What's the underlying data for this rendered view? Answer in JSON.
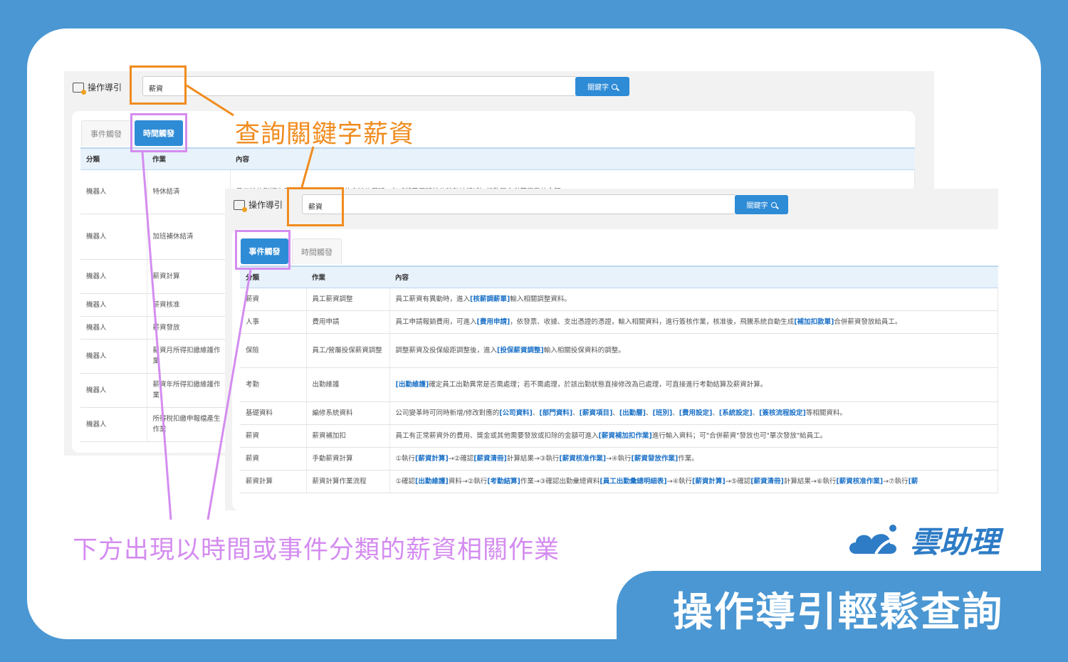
{
  "guide_label": "操作導引",
  "search": {
    "value": "薪資",
    "button": "關鍵字"
  },
  "tabs": {
    "event": "事件觸發",
    "time": "時間觸發"
  },
  "headers": [
    "分類",
    "作業",
    "內容"
  ],
  "panel1_rows": [
    {
      "cat": "機器人",
      "job": "特休結清",
      "content": "員工特休到期次日，系統執行當年未休完特休展延一年或將已展延特休時數結轉補加扣款單合併薪資發放金額。"
    },
    {
      "cat": "機器人",
      "job": "加班補休結清",
      "content": ""
    },
    {
      "cat": "機器人",
      "job": "薪資計算",
      "content": ""
    },
    {
      "cat": "機器人",
      "job": "薪資核准",
      "content": ""
    },
    {
      "cat": "機器人",
      "job": "薪資發放",
      "content": ""
    },
    {
      "cat": "機器人",
      "job": "薪資月所得扣繳維護作業",
      "content": ""
    },
    {
      "cat": "機器人",
      "job": "薪資年所得扣繳維護作業",
      "content": ""
    },
    {
      "cat": "機器人",
      "job": "所得稅扣繳申報檔產生作業",
      "content": ""
    }
  ],
  "panel2_rows": [
    {
      "cat": "薪資",
      "job": "員工薪資調整",
      "content": "員工薪資有異動時，進入[核薪調薪單]輸入相關調整資料。"
    },
    {
      "cat": "人事",
      "job": "費用申請",
      "content": "員工申請報銷費用，可進入[費用申請]，依發票、收據、支出憑證的憑證，輸入相關資料，進行簽核作業，核准後，飛騰系統自動生成[補加扣款單]合併薪資發放給員工。"
    },
    {
      "cat": "保險",
      "job": "員工/營屬投保薪資調整",
      "content": "調整薪資及投保級距調整後，進入[投保薪資調整]輸入相關投保資料的調整。"
    },
    {
      "cat": "考勤",
      "job": "出勤維護",
      "content": "[出勤維護]確定員工出勤異常是否需處理；若不需處理，於該出勤狀態直接修改為已處理，可直接進行考勤結算及薪資計算。"
    },
    {
      "cat": "基礎資料",
      "job": "編修系統資料",
      "content": "公司變革時可同時新增/修改對應的[公司資料]、[部門資料]、[薪資項目]、[出勤曆]、[班別]、[費用設定]、[系統設定]、[簽核流程設定]等相關資料。"
    },
    {
      "cat": "薪資",
      "job": "薪資補加扣",
      "content": "員工有正常薪資外的費用、獎金或其他需要發放或扣除的金額可進入[薪資補加扣作業]進行輸入資料；可\"合併薪資\"發放也可\"單次發放\"給員工。"
    },
    {
      "cat": "薪資",
      "job": "手動薪資計算",
      "content": "①執行[薪資計算]→②確認[薪資清冊]計算結果→③執行[薪資核准作業]→④執行[薪資發放作業]作業。"
    },
    {
      "cat": "薪資計算",
      "job": "薪資計算作業流程",
      "content": "①確認[出勤維護]資料→②執行[考勤結算]作業→③確認出勤彙總資料[員工出勤彙總明細表]→④執行[薪資計算]→⑤確認[薪資清冊]計算結果→⑥執行[薪資核准作業]→⑦執行[薪"
    }
  ],
  "callouts": {
    "keyword": "查詢關鍵字薪資",
    "result": "下方出現以時間或事件分類的薪資相關作業"
  },
  "brand": {
    "name": "雲助理"
  },
  "footer": {
    "text": "操作導引輕鬆查詢"
  },
  "colors": {
    "accent": "#2e8bd6",
    "orange": "#f08b1e",
    "violet": "#d48cf0",
    "bg": "#4a97d3"
  }
}
